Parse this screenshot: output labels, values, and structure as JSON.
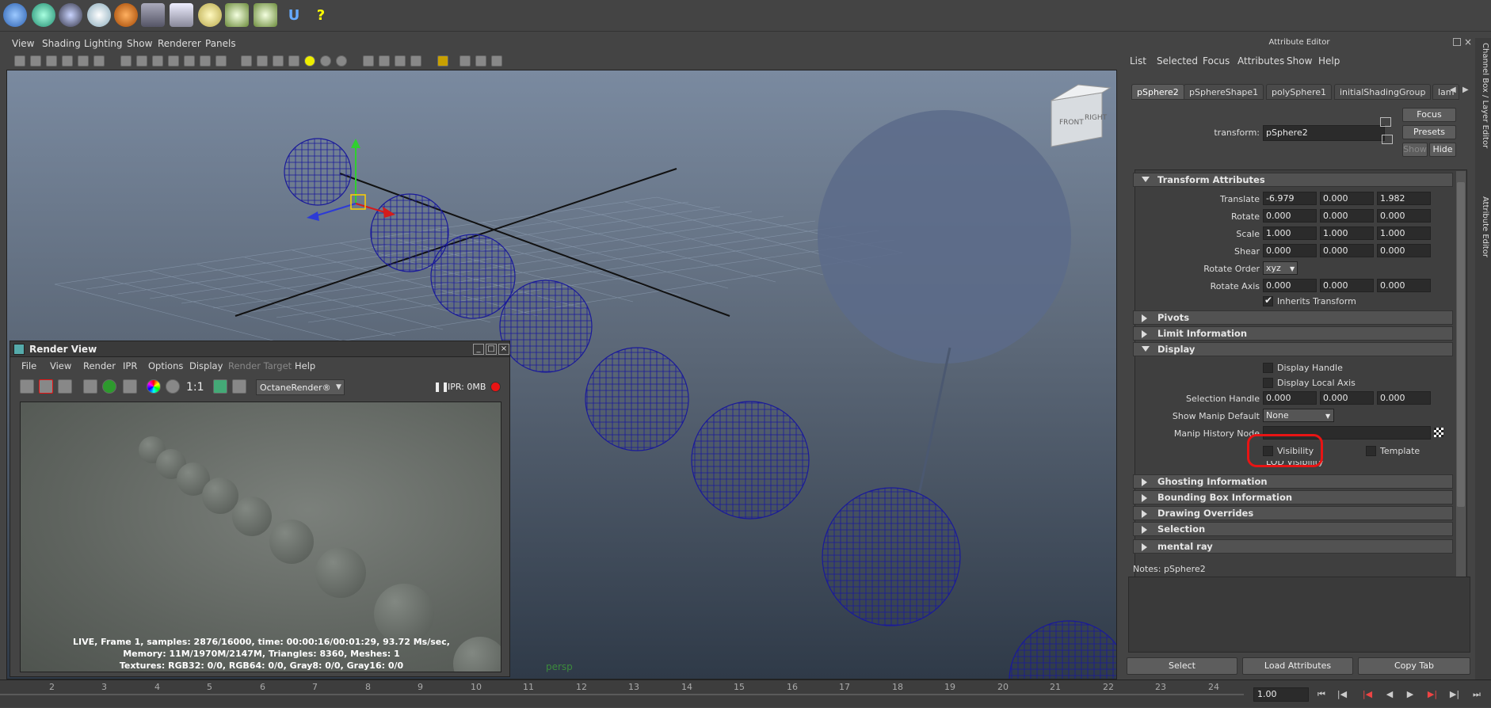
{
  "shelf": {
    "icons": [
      "globe-blue-icon",
      "globe-cyan-icon",
      "globe-dark-icon",
      "gear-cog-icon",
      "cube-orange-icon",
      "camera-icon",
      "layers-icon",
      "lightbulb-icon",
      "splash-icon",
      "splash-2-icon",
      "u-letter-icon",
      "help-icon"
    ],
    "u_label": "U",
    "help_label": "?"
  },
  "panel_menu": [
    "View",
    "Shading",
    "Lighting",
    "Show",
    "Renderer",
    "Panels"
  ],
  "viewport": {
    "label": "persp",
    "cube_front": "FRONT",
    "cube_right": "RIGHT"
  },
  "render_view": {
    "title": "Render View",
    "menu": [
      "File",
      "View",
      "Render",
      "IPR",
      "Options",
      "Display",
      "Render Target",
      "Help"
    ],
    "ratio": "1:1",
    "renderer": "OctaneRender®",
    "ipr_status": "IPR: 0MB",
    "stats_1": "LIVE, Frame 1, samples: 2876/16000, time: 00:00:16/00:01:29, 93.72 Ms/sec,",
    "stats_2": "Memory: 11M/1970M/2147M, Triangles: 8360, Meshes: 1",
    "stats_3": "Textures: RGB32: 0/0, RGB64: 0/0, Gray8: 0/0, Gray16: 0/0"
  },
  "attribute_editor": {
    "title": "Attribute Editor",
    "menu": [
      "List",
      "Selected",
      "Focus",
      "Attributes",
      "Show",
      "Help"
    ],
    "tabs": [
      "pSphere2",
      "pSphereShape1",
      "polySphere1",
      "initialShadingGroup",
      "lam"
    ],
    "transform_label": "transform:",
    "transform_value": "pSphere2",
    "focus_btn": "Focus",
    "presets_btn": "Presets",
    "show_btn": "Show",
    "hide_btn": "Hide",
    "transform_section": "Transform Attributes",
    "translate_label": "Translate",
    "translate": [
      "-6.979",
      "0.000",
      "1.982"
    ],
    "rotate_label": "Rotate",
    "rotate": [
      "0.000",
      "0.000",
      "0.000"
    ],
    "scale_label": "Scale",
    "scale": [
      "1.000",
      "1.000",
      "1.000"
    ],
    "shear_label": "Shear",
    "shear": [
      "0.000",
      "0.000",
      "0.000"
    ],
    "rotate_order_label": "Rotate Order",
    "rotate_order": "xyz",
    "rotate_axis_label": "Rotate Axis",
    "rotate_axis": [
      "0.000",
      "0.000",
      "0.000"
    ],
    "inherits_transform": "Inherits Transform",
    "pivots": "Pivots",
    "limit_info": "Limit Information",
    "display": "Display",
    "display_handle": "Display Handle",
    "display_local_axis": "Display Local Axis",
    "selection_handle_label": "Selection Handle",
    "selection_handle": [
      "0.000",
      "0.000",
      "0.000"
    ],
    "show_manip_label": "Show Manip Default",
    "show_manip": "None",
    "manip_history_label": "Manip History Node",
    "visibility": "Visibility",
    "template": "Template",
    "lod_visibility": "LOD Visibility",
    "ghosting": "Ghosting Information",
    "bounding_box": "Bounding Box Information",
    "drawing_overrides": "Drawing Overrides",
    "selection": "Selection",
    "mental_ray": "mental ray",
    "notes_label": "Notes:  pSphere2",
    "select_btn": "Select",
    "load_btn": "Load Attributes",
    "copy_btn": "Copy Tab"
  },
  "side_tabs": [
    "Channel Box / Layer Editor",
    "Attribute Editor"
  ],
  "timeline": {
    "ticks": [
      "2",
      "3",
      "4",
      "5",
      "6",
      "7",
      "8",
      "9",
      "10",
      "11",
      "12",
      "13",
      "14",
      "15",
      "16",
      "17",
      "18",
      "19",
      "20",
      "21",
      "22",
      "23",
      "24"
    ],
    "current_time": "1.00"
  },
  "colors": {
    "accent_red": "#e81414",
    "wire_blue": "#1a1a9a",
    "persp_green": "#3c8a3c"
  }
}
